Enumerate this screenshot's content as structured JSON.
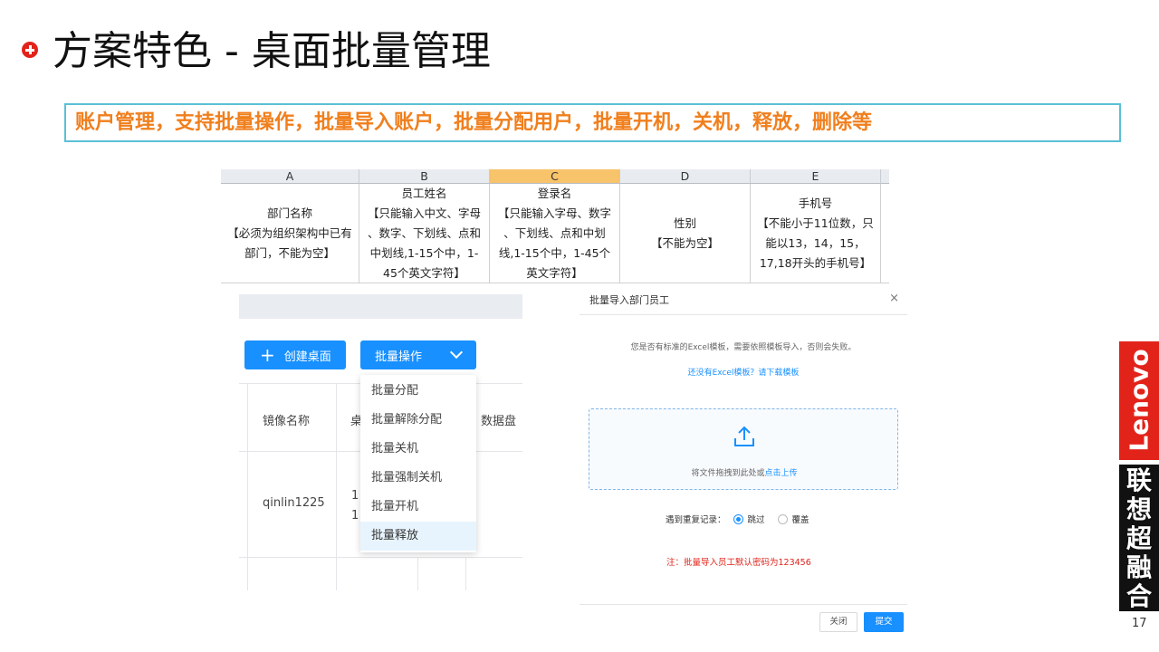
{
  "slide": {
    "title": "方案特色 - 桌面批量管理",
    "subtitle": "账户管理，支持批量操作，批量导入账户，批量分配用户，批量开机，关机，释放，删除等",
    "page_number": "17"
  },
  "spreadsheet": {
    "columns": [
      {
        "letter": "A",
        "content": "部门名称\n【必须为组织架构中已有\n部门，不能为空】"
      },
      {
        "letter": "B",
        "content": "员工姓名\n【只能输入中文、字母\n、数字、下划线、点和\n中划线,1-15个中，1-\n45个英文字符】"
      },
      {
        "letter": "C",
        "content": "登录名\n【只能输入字母、数字\n、下划线、点和中划\n线,1-15个中，1-45个\n英文字符】"
      },
      {
        "letter": "D",
        "content": "性别\n【不能为空】"
      },
      {
        "letter": "E",
        "content": "手机号\n【不能小于11位数，只\n能以13，14，15，\n17,18开头的手机号】"
      }
    ]
  },
  "desktop_app": {
    "create_button": "创建桌面",
    "batch_button": "批量操作",
    "table": {
      "headers": [
        "镜像名称",
        "桌",
        "数据盘"
      ],
      "row_name": "qinlin1225",
      "row_partial": [
        "1",
        "1"
      ]
    },
    "dropdown_items": [
      "批量分配",
      "批量解除分配",
      "批量关机",
      "批量强制关机",
      "批量开机",
      "批量释放"
    ]
  },
  "import_dialog": {
    "title": "批量导入部门员工",
    "close": "×",
    "tip": "您是否有标准的Excel模板，需要依照模板导入，否则会失败。",
    "template_link": "还没有Excel模板？请下载模板",
    "upload_text": "将文件拖拽到此处或",
    "upload_link": "点击上传",
    "duplicate_label": "遇到重复记录：",
    "option_skip": "跳过",
    "option_overwrite": "覆盖",
    "note": "注：批量导入员工默认密码为123456",
    "btn_close": "关闭",
    "btn_submit": "提交"
  },
  "brand": {
    "logo_text": "Lenovo",
    "tagline": [
      "联",
      "想",
      "超",
      "融",
      "合"
    ]
  }
}
